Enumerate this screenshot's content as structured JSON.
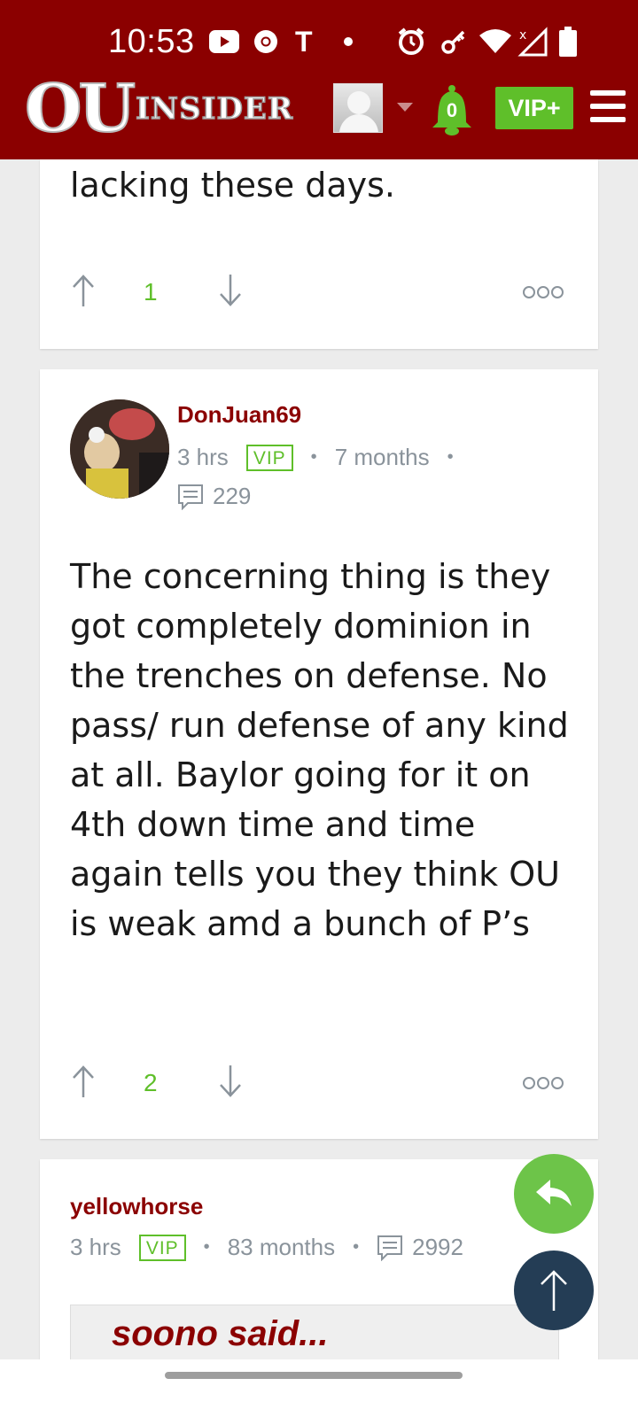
{
  "status_bar": {
    "time": "10:53"
  },
  "header": {
    "logo_ou": "OU",
    "logo_word": "INSIDER",
    "notification_count": "0",
    "vip_label": "VIP+"
  },
  "posts": [
    {
      "text": "lacking these days.",
      "votes": "1"
    },
    {
      "username": "DonJuan69",
      "time": "3 hrs",
      "badge": "VIP",
      "membership": "7 months",
      "comments": "229",
      "text": "The concerning thing is they got completely dominion in the trenches on defense. No pass/ run defense of any kind at all. Baylor going for it on 4th down time and time again tells you they think OU is weak amd a bunch of P’s",
      "votes": "2"
    },
    {
      "username": "yellowhorse",
      "time": "3 hrs",
      "badge": "VIP",
      "membership": "83 months",
      "comments": "2992",
      "quote_author": "soono said..."
    }
  ],
  "colors": {
    "brand": "#8b0000",
    "accent": "#5fbf2a",
    "fab_reply": "#6dc449",
    "fab_top": "#243d55"
  }
}
